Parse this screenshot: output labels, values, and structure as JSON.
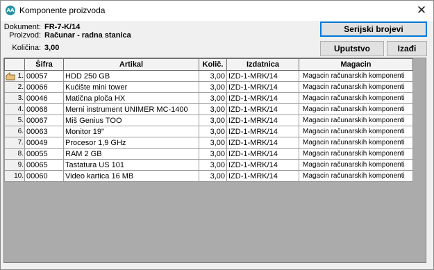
{
  "window": {
    "title": "Komponente proizvoda",
    "icon": "app-logo-icon",
    "app_icon_text": "AA",
    "close_glyph": "✕"
  },
  "info": {
    "dokument_label": "Dokument:",
    "dokument_value": "FR-7-K/14",
    "proizvod_label": "Proizvod:",
    "proizvod_value": "Računar - radna stanica",
    "kolicina_label": "Količina:",
    "kolicina_value": "3,00"
  },
  "buttons": {
    "serijski": "Serijski brojevi",
    "uputstvo": "Uputstvo",
    "izadji": "Izađi"
  },
  "table": {
    "columns": [
      "Šifra",
      "Artikal",
      "Količ.",
      "Izdatnica",
      "Magacin"
    ],
    "rows": [
      {
        "n": "1.",
        "sifra": "00057",
        "artikal": "HDD 250 GB",
        "kol": "3,00",
        "izdatnica": "IZD-1-MRK/14",
        "magacin": "Magacin računarskih komponenti"
      },
      {
        "n": "2.",
        "sifra": "00066",
        "artikal": "Kućište mini tower",
        "kol": "3,00",
        "izdatnica": "IZD-1-MRK/14",
        "magacin": "Magacin računarskih komponenti"
      },
      {
        "n": "3.",
        "sifra": "00046",
        "artikal": "Matična ploča HX",
        "kol": "3,00",
        "izdatnica": "IZD-1-MRK/14",
        "magacin": "Magacin računarskih komponenti"
      },
      {
        "n": "4.",
        "sifra": "00068",
        "artikal": "Merni instrument UNIMER MC-1400",
        "kol": "3,00",
        "izdatnica": "IZD-1-MRK/14",
        "magacin": "Magacin računarskih komponenti"
      },
      {
        "n": "5.",
        "sifra": "00067",
        "artikal": "Miš Genius TOO",
        "kol": "3,00",
        "izdatnica": "IZD-1-MRK/14",
        "magacin": "Magacin računarskih komponenti"
      },
      {
        "n": "6.",
        "sifra": "00063",
        "artikal": "Monitor 19\"",
        "kol": "3,00",
        "izdatnica": "IZD-1-MRK/14",
        "magacin": "Magacin računarskih komponenti"
      },
      {
        "n": "7.",
        "sifra": "00049",
        "artikal": "Procesor 1,9 GHz",
        "kol": "3,00",
        "izdatnica": "IZD-1-MRK/14",
        "magacin": "Magacin računarskih komponenti"
      },
      {
        "n": "8.",
        "sifra": "00055",
        "artikal": "RAM 2 GB",
        "kol": "3,00",
        "izdatnica": "IZD-1-MRK/14",
        "magacin": "Magacin računarskih komponenti"
      },
      {
        "n": "9.",
        "sifra": "00065",
        "artikal": "Tastatura US 101",
        "kol": "3,00",
        "izdatnica": "IZD-1-MRK/14",
        "magacin": "Magacin računarskih komponenti"
      },
      {
        "n": "10.",
        "sifra": "00060",
        "artikal": "Video kartica 16 MB",
        "kol": "3,00",
        "izdatnica": "IZD-1-MRK/14",
        "magacin": "Magacin računarskih komponenti"
      }
    ]
  },
  "colors": {
    "accent": "#0078d7",
    "app_icon": "#2e8fa3",
    "grid_empty": "#ababab"
  }
}
